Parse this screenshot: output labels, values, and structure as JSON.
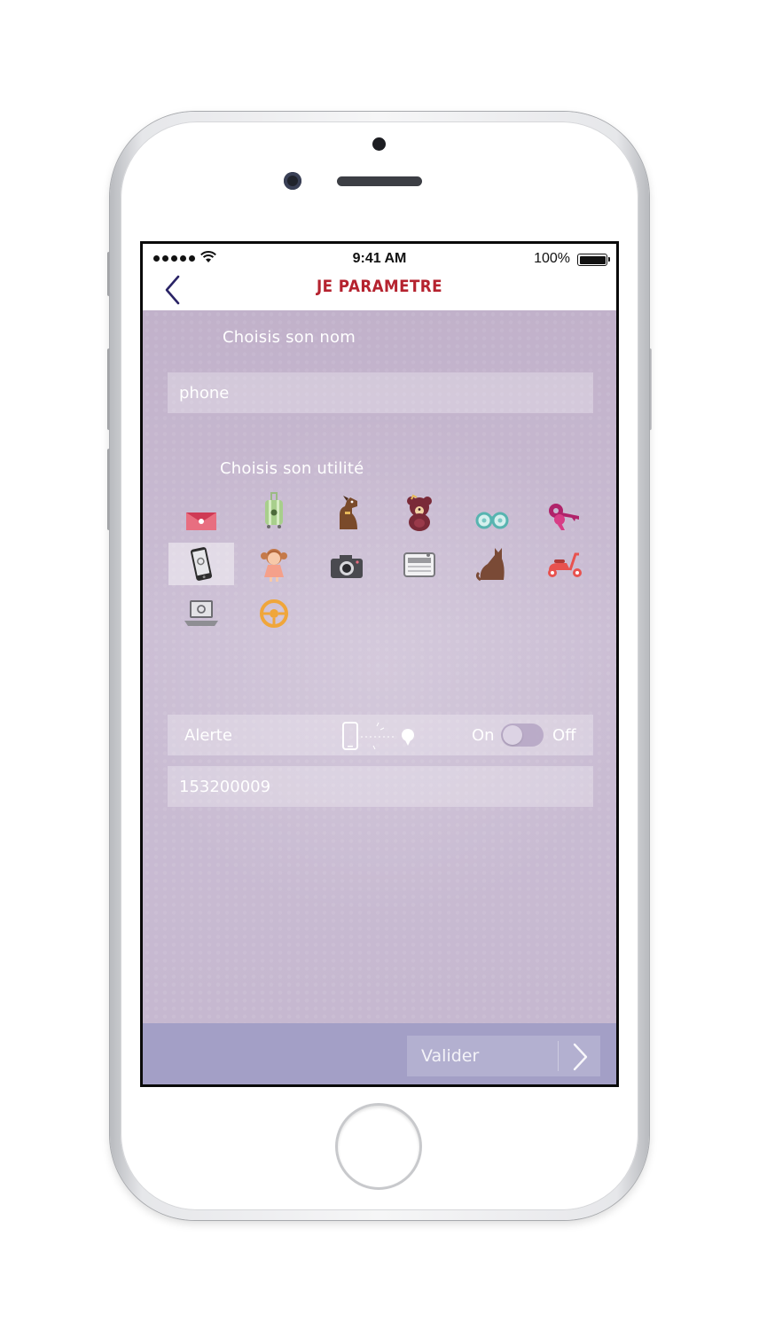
{
  "status_bar": {
    "time": "9:41 AM",
    "battery": "100%"
  },
  "nav": {
    "title": "JE PARAMETRE",
    "back_icon": "chevron-left-icon"
  },
  "name_section": {
    "label": "Choisis son nom",
    "value": "phone"
  },
  "use_section": {
    "label": "Choisis son utilité",
    "selected": "phone",
    "icons": [
      "envelope",
      "suitcase",
      "dog",
      "teddy-bear",
      "glasses",
      "keys",
      "phone",
      "girl",
      "camera",
      "radio",
      "cat",
      "scooter",
      "laptop",
      "steering-wheel"
    ]
  },
  "alert": {
    "label": "Alerte",
    "on_label": "On",
    "off_label": "Off",
    "state": "off"
  },
  "tag_id": {
    "value": "153200009"
  },
  "footer": {
    "validate_label": "Valider"
  },
  "colors": {
    "accent": "#b5232f",
    "background": "#c6b8d0",
    "footer": "#a39fc6",
    "back": "#2a2466"
  }
}
